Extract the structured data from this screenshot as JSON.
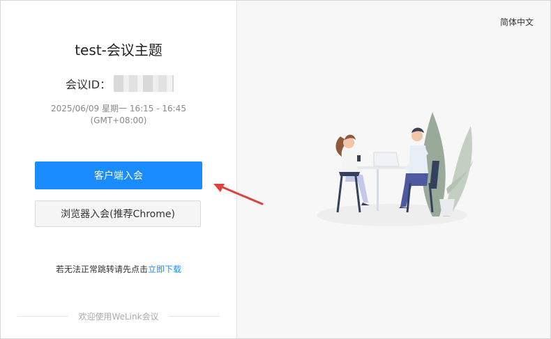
{
  "meeting": {
    "title": "test-会议主题",
    "id_label": "会议ID：",
    "time_line1": "2025/06/09 星期一 16:15 - 16:45",
    "time_line2": "(GMT+08:00)"
  },
  "actions": {
    "client_join": "客户端入会",
    "browser_join": "浏览器入会(推荐Chrome)"
  },
  "hint": {
    "text": "若无法正常跳转请先点击",
    "link": "立即下载"
  },
  "footer": {
    "text": "欢迎使用WeLink会议"
  },
  "language": {
    "selected": "简体中文"
  },
  "colors": {
    "primary": "#1a8cff",
    "annotation_arrow": "#e0413c"
  }
}
